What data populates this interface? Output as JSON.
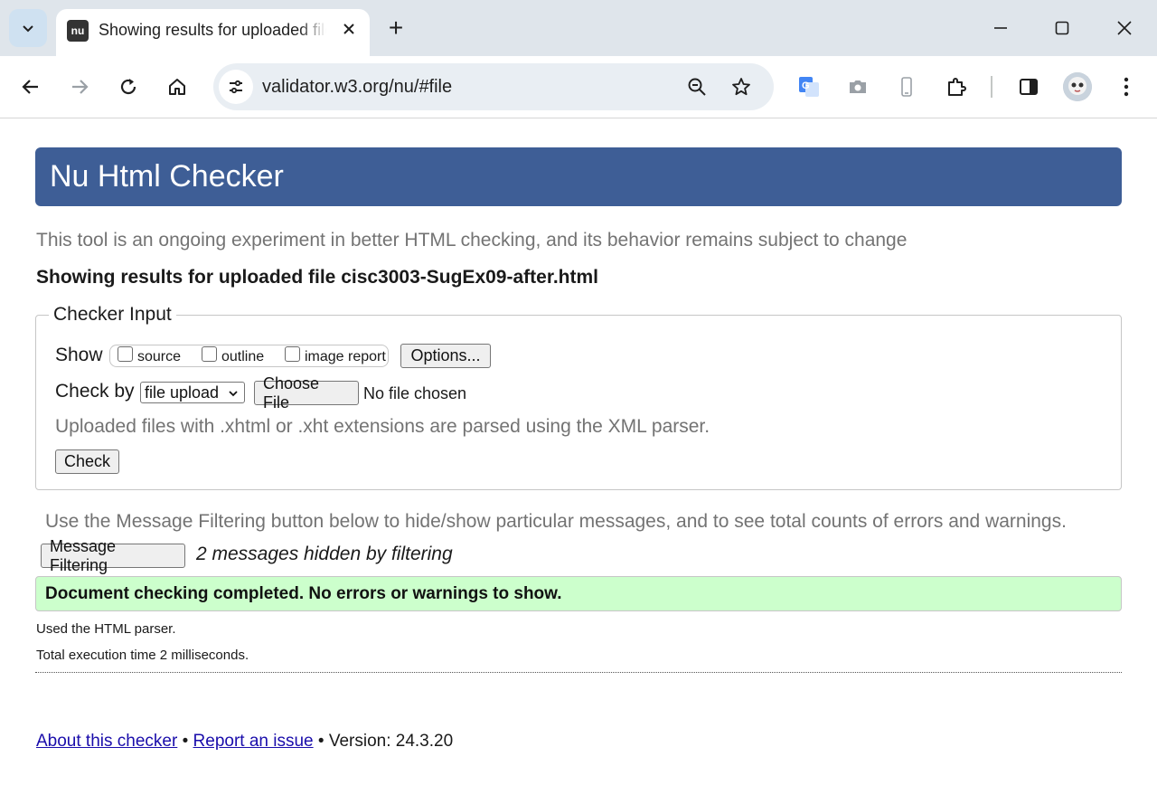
{
  "browser": {
    "tab": {
      "favicon_text": "nu",
      "title": "Showing results for uploaded file cisc3003-SugEx09-after.html"
    },
    "new_tab_label": "+",
    "omnibox": {
      "url": "validator.w3.org/nu/#file"
    }
  },
  "page": {
    "banner_title": "Nu Html Checker",
    "tagline": "This tool is an ongoing experiment in better HTML checking, and its behavior remains subject to change",
    "results_heading": "Showing results for uploaded file cisc3003-SugEx09-after.html",
    "checker_input": {
      "legend": "Checker Input",
      "show_label": "Show",
      "show_options": [
        {
          "label": "source",
          "checked": false
        },
        {
          "label": "outline",
          "checked": false
        },
        {
          "label": "image report",
          "checked": false
        }
      ],
      "options_button": "Options...",
      "check_by_label": "Check by",
      "check_by_selected": "file upload",
      "choose_file_button": "Choose File",
      "no_file_text": "No file chosen",
      "hint": "Uploaded files with .xhtml or .xht extensions are parsed using the XML parser.",
      "check_button": "Check"
    },
    "filter_note": "Use the Message Filtering button below to hide/show particular messages, and to see total counts of errors and warnings.",
    "message_filtering_button": "Message Filtering",
    "hidden_messages": "2 messages hidden by filtering",
    "success_message": "Document checking completed. No errors or warnings to show.",
    "parser_note": "Used the HTML parser.",
    "execution_time": "Total execution time 2 milliseconds.",
    "footer": {
      "about_link": "About this checker",
      "bullet": "•",
      "report_link": "Report an issue",
      "version_text": "Version: 24.3.20"
    }
  }
}
